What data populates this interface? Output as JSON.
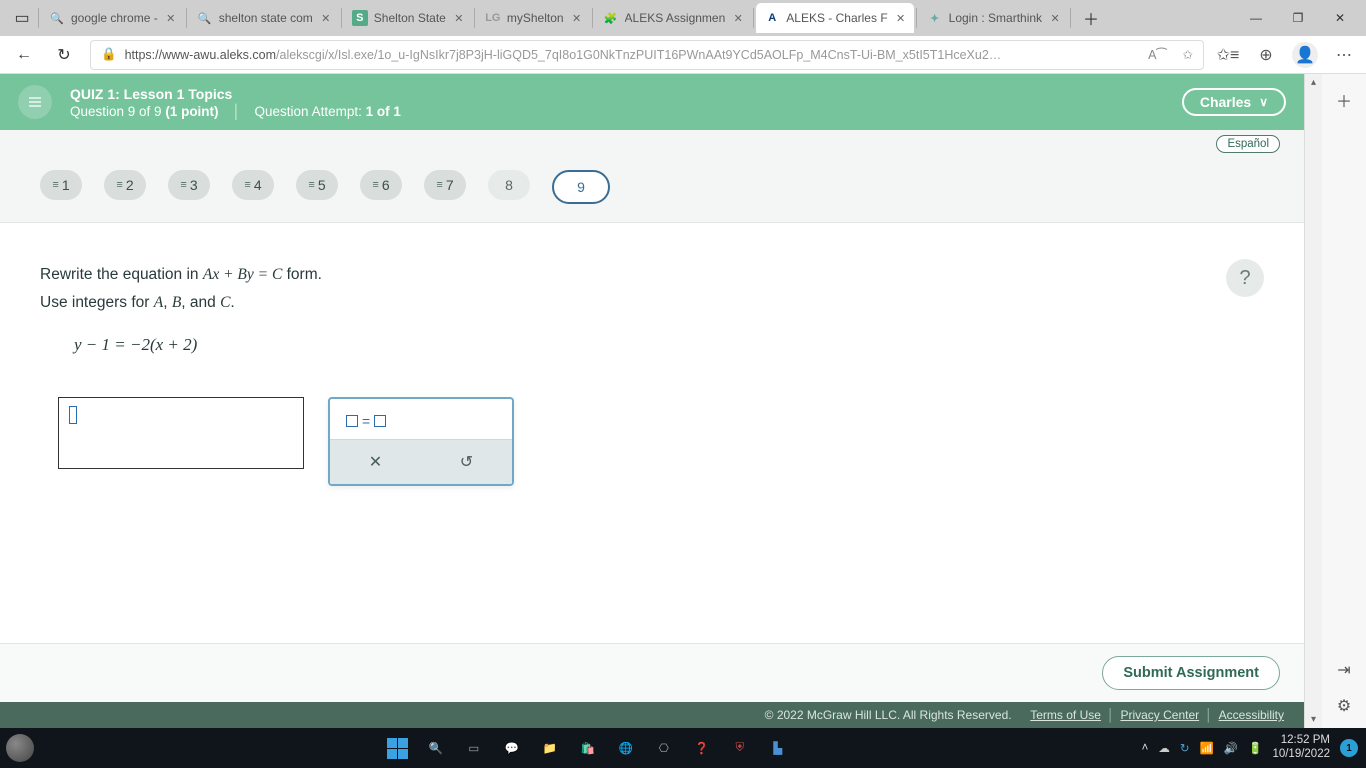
{
  "browser": {
    "tabs": [
      {
        "favicon": "mag",
        "title": "google chrome -"
      },
      {
        "favicon": "mag",
        "title": "shelton state com"
      },
      {
        "favicon": "sh",
        "title": "Shelton State"
      },
      {
        "favicon": "lg",
        "title": "myShelton"
      },
      {
        "favicon": "al",
        "title": "ALEKS Assignmen"
      },
      {
        "favicon": "A",
        "title": "ALEKS - Charles F"
      },
      {
        "favicon": "sm",
        "title": "Login : Smarthink"
      }
    ],
    "url_host": "https://www-awu.aleks.com",
    "url_path": "/alekscgi/x/Isl.exe/1o_u-IgNsIkr7j8P3jH-liGQD5_7qI8o1G0NkTnzPUIT16PWnAAt9YCd5AOLFp_M4CnsT-Ui-BM_x5tI5T1HceXu2…",
    "reader": "A⁀"
  },
  "header": {
    "quiz_title": "QUIZ 1: Lesson 1 Topics",
    "question_line_a": "Question 9 of 9 ",
    "question_line_b": "(1 point)",
    "attempt_prefix": "Question Attempt: ",
    "attempt_value": "1 of 1",
    "user": "Charles",
    "espanol": "Español"
  },
  "nav": {
    "items": [
      {
        "n": "1",
        "eq": true
      },
      {
        "n": "2",
        "eq": true
      },
      {
        "n": "3",
        "eq": true
      },
      {
        "n": "4",
        "eq": true
      },
      {
        "n": "5",
        "eq": true
      },
      {
        "n": "6",
        "eq": true
      },
      {
        "n": "7",
        "eq": true
      },
      {
        "n": "8",
        "eq": false
      },
      {
        "n": "9",
        "eq": false,
        "current": true
      }
    ]
  },
  "question": {
    "line1_pre": "Rewrite the equation in ",
    "line1_eq": "Ax + By = C",
    "line1_post": " form.",
    "line2_pre": "Use integers for ",
    "line2_a": "A",
    "line2_c1": ", ",
    "line2_b": "B",
    "line2_c2": ", and ",
    "line2_c": "C",
    "line2_post": ".",
    "equation": "y − 1 = −2(x + 2)",
    "help": "?"
  },
  "keypad": {
    "eq_label": "=",
    "clear": "✕",
    "undo": "↺"
  },
  "submit": {
    "label": "Submit Assignment"
  },
  "footer": {
    "copyright": "© 2022 McGraw Hill LLC. All Rights Reserved.",
    "terms": "Terms of Use",
    "privacy": "Privacy Center",
    "accessibility": "Accessibility"
  },
  "system": {
    "time": "12:52 PM",
    "date": "10/19/2022",
    "notif": "1"
  }
}
